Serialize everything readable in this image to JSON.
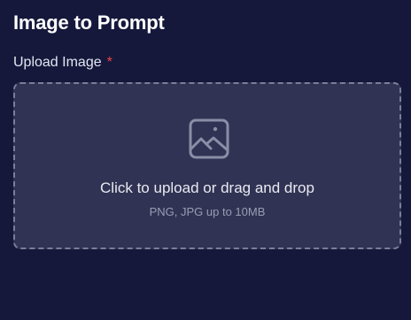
{
  "page": {
    "title": "Image to Prompt"
  },
  "upload": {
    "label": "Upload Image",
    "required_mark": "*",
    "primary_text": "Click to upload or drag and drop",
    "hint_text": "PNG, JPG up to 10MB",
    "icon": "image-icon"
  },
  "colors": {
    "background": "#15183b",
    "dropzone_background": "#303353",
    "dropzone_border": "#7a7f99",
    "required": "#ef4444",
    "hint": "#9a9db3"
  }
}
